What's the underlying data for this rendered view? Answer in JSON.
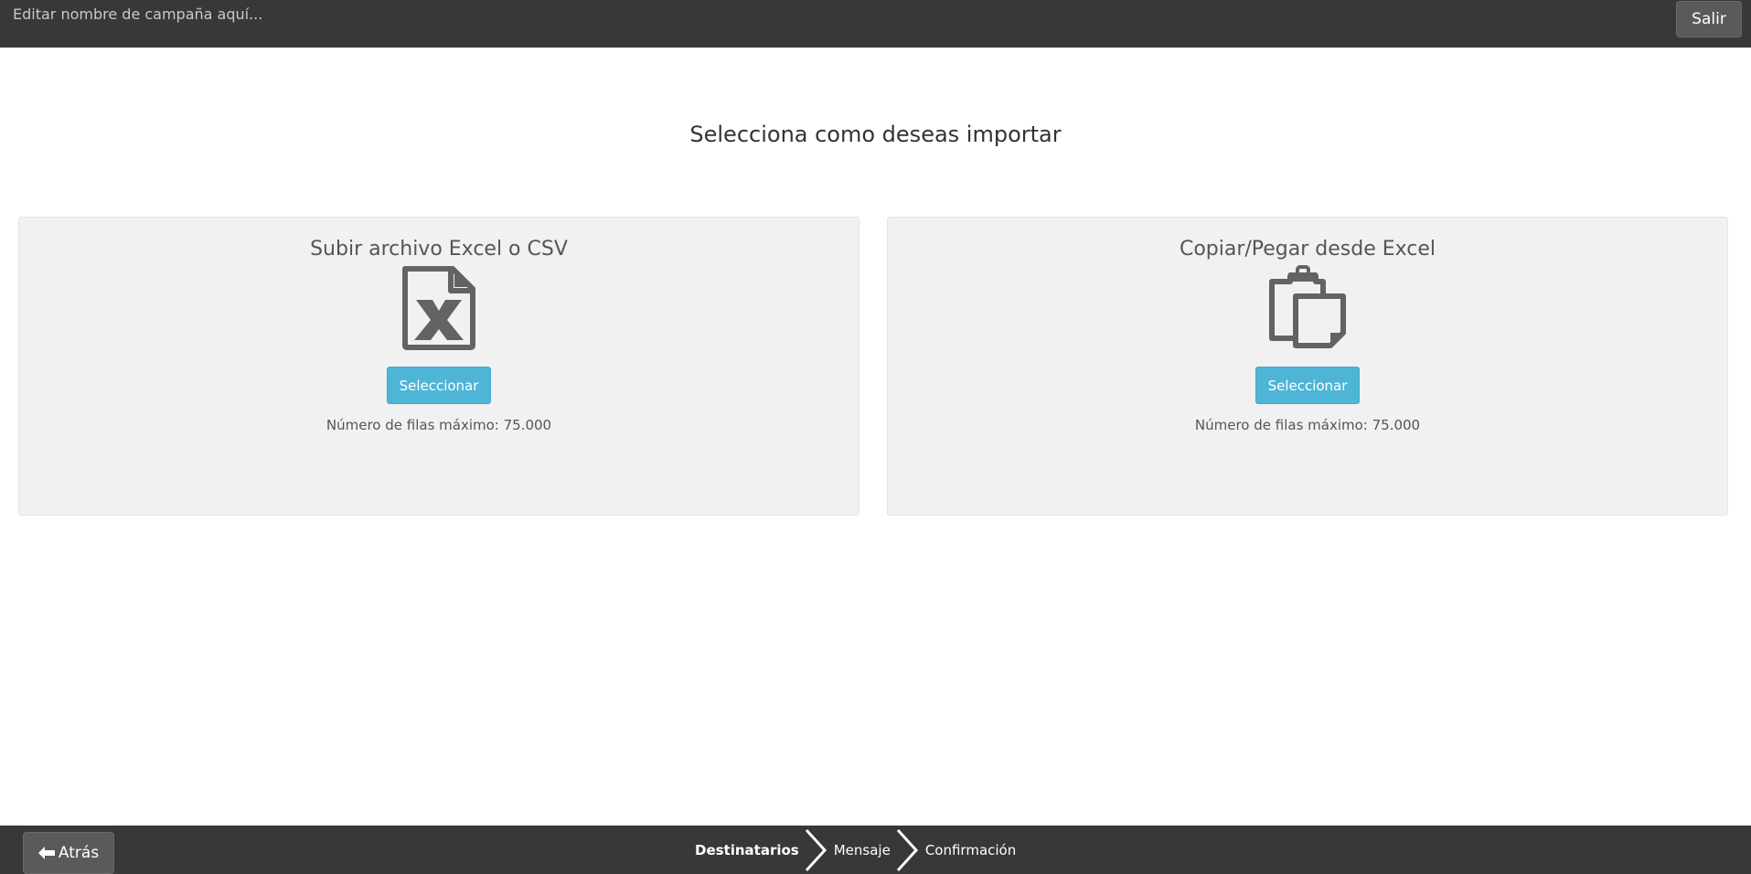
{
  "header": {
    "campaign_placeholder": "Editar nombre de campaña aquí...",
    "exit_label": "Salir"
  },
  "main": {
    "title": "Selecciona como deseas importar",
    "options": [
      {
        "title": "Subir archivo Excel o CSV",
        "icon": "excel-file-icon",
        "button_label": "Seleccionar",
        "info": "Número de filas máximo: 75.000"
      },
      {
        "title": "Copiar/Pegar desde Excel",
        "icon": "clipboard-paste-icon",
        "button_label": "Seleccionar",
        "info": "Número de filas máximo: 75.000"
      }
    ]
  },
  "footer": {
    "back_label": "Atrás",
    "steps": [
      {
        "label": "Destinatarios",
        "active": true
      },
      {
        "label": "Mensaje",
        "active": false
      },
      {
        "label": "Confirmación",
        "active": false
      }
    ]
  },
  "colors": {
    "bar_background": "#383839",
    "accent": "#4fb5d6",
    "card_background": "#f1f1f1"
  }
}
